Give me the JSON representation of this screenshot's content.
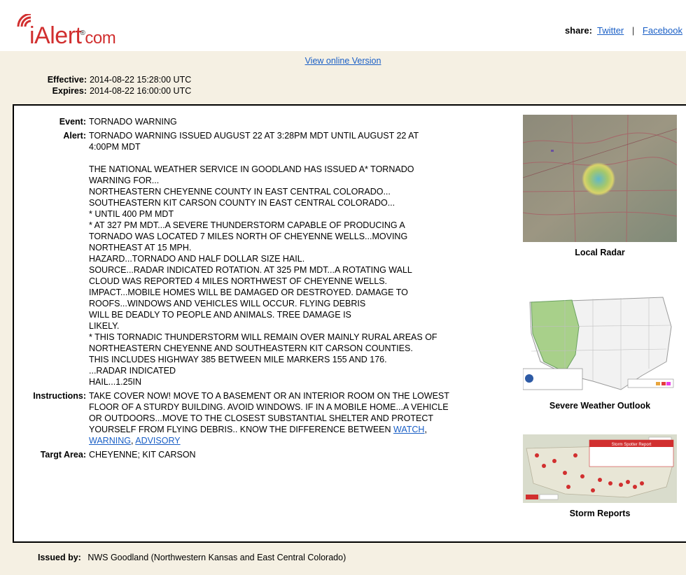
{
  "header": {
    "logo_text_i": "iAlert",
    "logo_text_com": "com",
    "logo_reg": "®",
    "share_label": "share:",
    "twitter": "Twitter",
    "separator": "|",
    "facebook": "Facebook"
  },
  "view_online": "View online Version",
  "dates": {
    "effective_label": "Effective:",
    "effective_value": "2014-08-22 15:28:00 UTC",
    "expires_label": "Expires:",
    "expires_value": "2014-08-22 16:00:00 UTC"
  },
  "alert": {
    "event_label": "Event:",
    "event_value": "TORNADO WARNING",
    "alert_label": "Alert:",
    "alert_heading_lines": [
      "TORNADO WARNING ISSUED AUGUST 22 AT 3:28PM MDT UNTIL AUGUST 22 AT",
      "4:00PM MDT"
    ],
    "alert_body_lines": [
      "THE NATIONAL WEATHER SERVICE IN GOODLAND HAS ISSUED A* TORNADO",
      "WARNING FOR...",
      "NORTHEASTERN CHEYENNE COUNTY IN EAST CENTRAL COLORADO...",
      "SOUTHEASTERN KIT CARSON COUNTY IN EAST CENTRAL COLORADO...",
      "* UNTIL 400 PM MDT",
      "* AT 327 PM MDT...A SEVERE THUNDERSTORM CAPABLE OF PRODUCING A",
      "TORNADO WAS LOCATED 7 MILES NORTH OF CHEYENNE WELLS...MOVING",
      "NORTHEAST AT 15 MPH.",
      "HAZARD...TORNADO AND HALF DOLLAR SIZE HAIL.",
      "SOURCE...RADAR INDICATED ROTATION. AT 325 PM MDT...A ROTATING WALL",
      "CLOUD WAS REPORTED 4 MILES NORTHWEST OF CHEYENNE WELLS.",
      "IMPACT...MOBILE HOMES WILL BE DAMAGED OR DESTROYED. DAMAGE TO",
      "ROOFS...WINDOWS AND VEHICLES WILL OCCUR. FLYING DEBRIS",
      "WILL BE DEADLY TO PEOPLE AND ANIMALS. TREE DAMAGE IS",
      "LIKELY.",
      "* THIS TORNADIC THUNDERSTORM WILL REMAIN OVER MAINLY RURAL AREAS OF",
      "NORTHEASTERN CHEYENNE AND SOUTHEASTERN KIT CARSON COUNTIES.",
      "THIS INCLUDES HIGHWAY 385 BETWEEN MILE MARKERS 155 AND 176.",
      "...RADAR INDICATED",
      "HAIL...1.25IN"
    ],
    "instructions_label": "Instructions:",
    "instructions_lines": [
      "TAKE COVER NOW! MOVE TO A BASEMENT OR AN INTERIOR ROOM ON THE LOWEST",
      "FLOOR OF A STURDY BUILDING. AVOID WINDOWS. IF IN A MOBILE HOME...A VEHICLE",
      "OR OUTDOORS...MOVE TO THE CLOSEST SUBSTANTIAL SHELTER AND PROTECT"
    ],
    "instructions_last_prefix": "YOURSELF FROM FLYING DEBRIS.. KNOW THE DIFFERENCE BETWEEN ",
    "link_watch": "WATCH",
    "link_warning": "WARNING",
    "link_advisory": "ADVISORY",
    "comma": ",",
    "target_label": "Targt Area:",
    "target_value": "CHEYENNE; KIT CARSON"
  },
  "media": {
    "radar_caption": "Local Radar",
    "outlook_caption": "Severe Weather Outlook",
    "reports_caption": "Storm Reports",
    "reports_popup_title": "Storm Spotter Report"
  },
  "footer": {
    "issued_label": "Issued by:",
    "issued_value": "NWS Goodland (Northwestern Kansas and East Central Colorado)"
  },
  "colors": {
    "brand_red": "#d12f2f",
    "link_blue": "#1a5fc6",
    "page_beige": "#f5f0e3"
  }
}
